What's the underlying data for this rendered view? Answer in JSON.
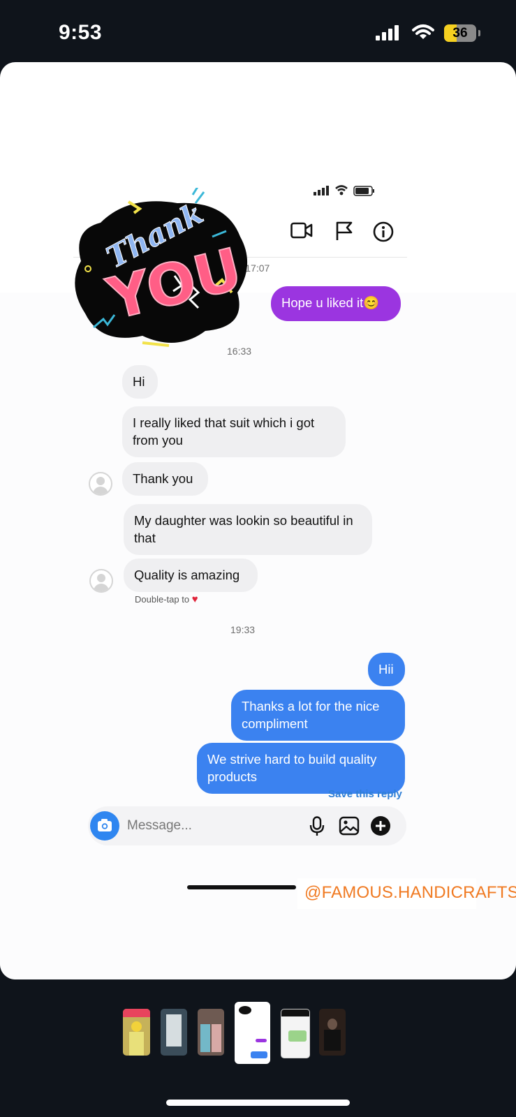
{
  "status_bar": {
    "time": "9:53",
    "battery": "36"
  },
  "sticker": {
    "text_top": "Thank",
    "text_big": "YOU"
  },
  "chat": {
    "date_divider": "29 APR, 17:07",
    "outgoing_1": "Hope u liked it",
    "outgoing_1_emoji": "😊",
    "time_1": "16:33",
    "incoming": [
      "Hi",
      "I really liked that suit which i got from you",
      "Thank you",
      "My daughter was lookin so beautiful in that",
      "Quality is amazing"
    ],
    "double_tap_hint": "Double-tap to",
    "time_2": "19:33",
    "replies": [
      "Hii",
      "Thanks a lot for the nice compliment",
      "We strive hard to build quality products"
    ],
    "save_reply": "Save this reply",
    "composer_placeholder": "Message..."
  },
  "overlay_handle": "@FAMOUS.HANDICRAFTS",
  "thumbnails": [
    "story-1",
    "story-2",
    "story-3",
    "story-4",
    "story-5",
    "story-6"
  ],
  "colors": {
    "purple_bubble": "#9b35e0",
    "blue_bubble": "#3b82f0",
    "handle": "#f07a22"
  }
}
